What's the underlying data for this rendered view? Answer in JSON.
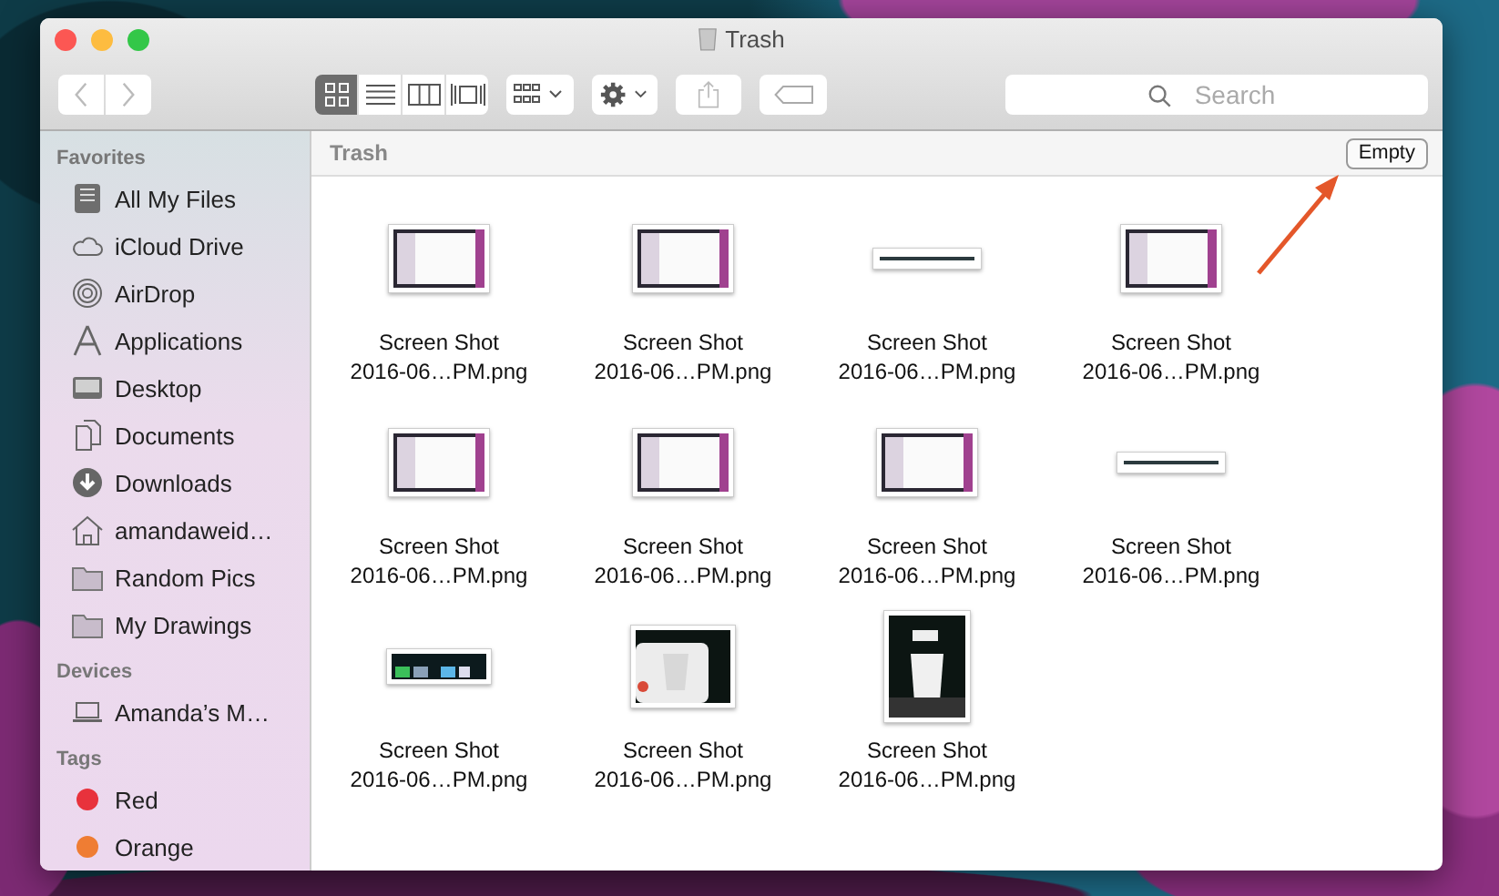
{
  "window": {
    "title": "Trash"
  },
  "toolbar": {
    "view_modes": [
      {
        "kind": "icons",
        "selected": true
      },
      {
        "kind": "list",
        "selected": false
      },
      {
        "kind": "columns",
        "selected": false
      },
      {
        "kind": "coverflow",
        "selected": false
      }
    ],
    "search": {
      "placeholder": "Search"
    }
  },
  "sidebar": {
    "sections": [
      {
        "title": "Favorites",
        "items": [
          {
            "label": "All My Files",
            "kind": "files"
          },
          {
            "label": "iCloud Drive",
            "kind": "cloud"
          },
          {
            "label": "AirDrop",
            "kind": "airdrop"
          },
          {
            "label": "Applications",
            "kind": "apps"
          },
          {
            "label": "Desktop",
            "kind": "desktop"
          },
          {
            "label": "Documents",
            "kind": "documents"
          },
          {
            "label": "Downloads",
            "kind": "downloads"
          },
          {
            "label": "amandaweid…",
            "kind": "home"
          },
          {
            "label": "Random Pics",
            "kind": "folder"
          },
          {
            "label": "My Drawings",
            "kind": "folder"
          }
        ]
      },
      {
        "title": "Devices",
        "items": [
          {
            "label": "Amanda’s M…",
            "kind": "laptop"
          }
        ]
      },
      {
        "title": "Tags",
        "items": [
          {
            "label": "Red",
            "kind": "tag",
            "color": "#e8323c"
          },
          {
            "label": "Orange",
            "kind": "tag",
            "color": "#ef7d33"
          }
        ]
      }
    ]
  },
  "path_bar": {
    "location": "Trash",
    "button": "Empty"
  },
  "files": [
    {
      "name": "Screen Shot",
      "name_2": "2016-06…PM.png",
      "kind": "picture"
    },
    {
      "name": "Screen Shot",
      "name_2": "2016-06…PM.png",
      "kind": "picture"
    },
    {
      "name": "Screen Shot",
      "name_2": "2016-06…PM.png",
      "kind": "picture"
    },
    {
      "name": "Screen Shot",
      "name_2": "2016-06…PM.png",
      "kind": "picture"
    },
    {
      "name": "Screen Shot",
      "name_2": "2016-06…PM.png",
      "kind": "picture"
    },
    {
      "name": "Screen Shot",
      "name_2": "2016-06…PM.png",
      "kind": "picture"
    },
    {
      "name": "Screen Shot",
      "name_2": "2016-06…PM.png",
      "kind": "picture"
    },
    {
      "name": "Screen Shot",
      "name_2": "2016-06…PM.png",
      "kind": "picture"
    },
    {
      "name": "Screen Shot",
      "name_2": "2016-06…PM.png",
      "kind": "picture"
    },
    {
      "name": "Screen Shot",
      "name_2": "2016-06…PM.png",
      "kind": "picture"
    },
    {
      "name": "Screen Shot",
      "name_2": "2016-06…PM.png",
      "kind": "picture"
    }
  ]
}
